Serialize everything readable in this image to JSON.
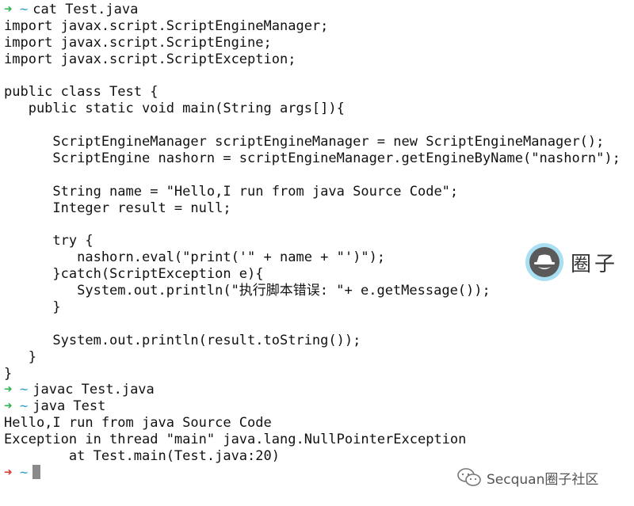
{
  "prompt": {
    "arrow": "➜",
    "tilde": "~"
  },
  "lines": [
    {
      "type": "prompt",
      "status": "ok",
      "text": "cat Test.java"
    },
    {
      "type": "output",
      "text": "import javax.script.ScriptEngineManager;"
    },
    {
      "type": "output",
      "text": "import javax.script.ScriptEngine;"
    },
    {
      "type": "output",
      "text": "import javax.script.ScriptException;"
    },
    {
      "type": "output",
      "text": ""
    },
    {
      "type": "output",
      "text": "public class Test {"
    },
    {
      "type": "output",
      "text": "   public static void main(String args[]){"
    },
    {
      "type": "output",
      "text": ""
    },
    {
      "type": "output",
      "text": "      ScriptEngineManager scriptEngineManager = new ScriptEngineManager();"
    },
    {
      "type": "output",
      "text": "      ScriptEngine nashorn = scriptEngineManager.getEngineByName(\"nashorn\");"
    },
    {
      "type": "output",
      "text": ""
    },
    {
      "type": "output",
      "text": "      String name = \"Hello,I run from java Source Code\";"
    },
    {
      "type": "output",
      "text": "      Integer result = null;"
    },
    {
      "type": "output",
      "text": ""
    },
    {
      "type": "output",
      "text": "      try {"
    },
    {
      "type": "output",
      "text": "         nashorn.eval(\"print('\" + name + \"')\");"
    },
    {
      "type": "output",
      "text": "      }catch(ScriptException e){"
    },
    {
      "type": "output",
      "text": "         System.out.println(\"执行脚本错误: \"+ e.getMessage());"
    },
    {
      "type": "output",
      "text": "      }"
    },
    {
      "type": "output",
      "text": ""
    },
    {
      "type": "output",
      "text": "      System.out.println(result.toString());"
    },
    {
      "type": "output",
      "text": "   }"
    },
    {
      "type": "output",
      "text": "}"
    },
    {
      "type": "prompt",
      "status": "ok",
      "text": "javac Test.java"
    },
    {
      "type": "prompt",
      "status": "ok",
      "text": "java Test"
    },
    {
      "type": "output",
      "text": "Hello,I run from java Source Code"
    },
    {
      "type": "output",
      "text": "Exception in thread \"main\" java.lang.NullPointerException"
    },
    {
      "type": "output",
      "text": "        at Test.main(Test.java:20)"
    },
    {
      "type": "prompt",
      "status": "err",
      "text": "",
      "cursor": true
    }
  ],
  "watermark": {
    "label": "圈子",
    "icon": "spy-hat-icon",
    "badge_color": "#a9dff2"
  },
  "footer": {
    "icon": "wechat-icon",
    "label": "Secquan圈子社区"
  },
  "colors": {
    "prompt_ok": "#2bb24c",
    "prompt_err": "#d93a2b",
    "tilde": "#27a1c7",
    "text": "#111111"
  }
}
